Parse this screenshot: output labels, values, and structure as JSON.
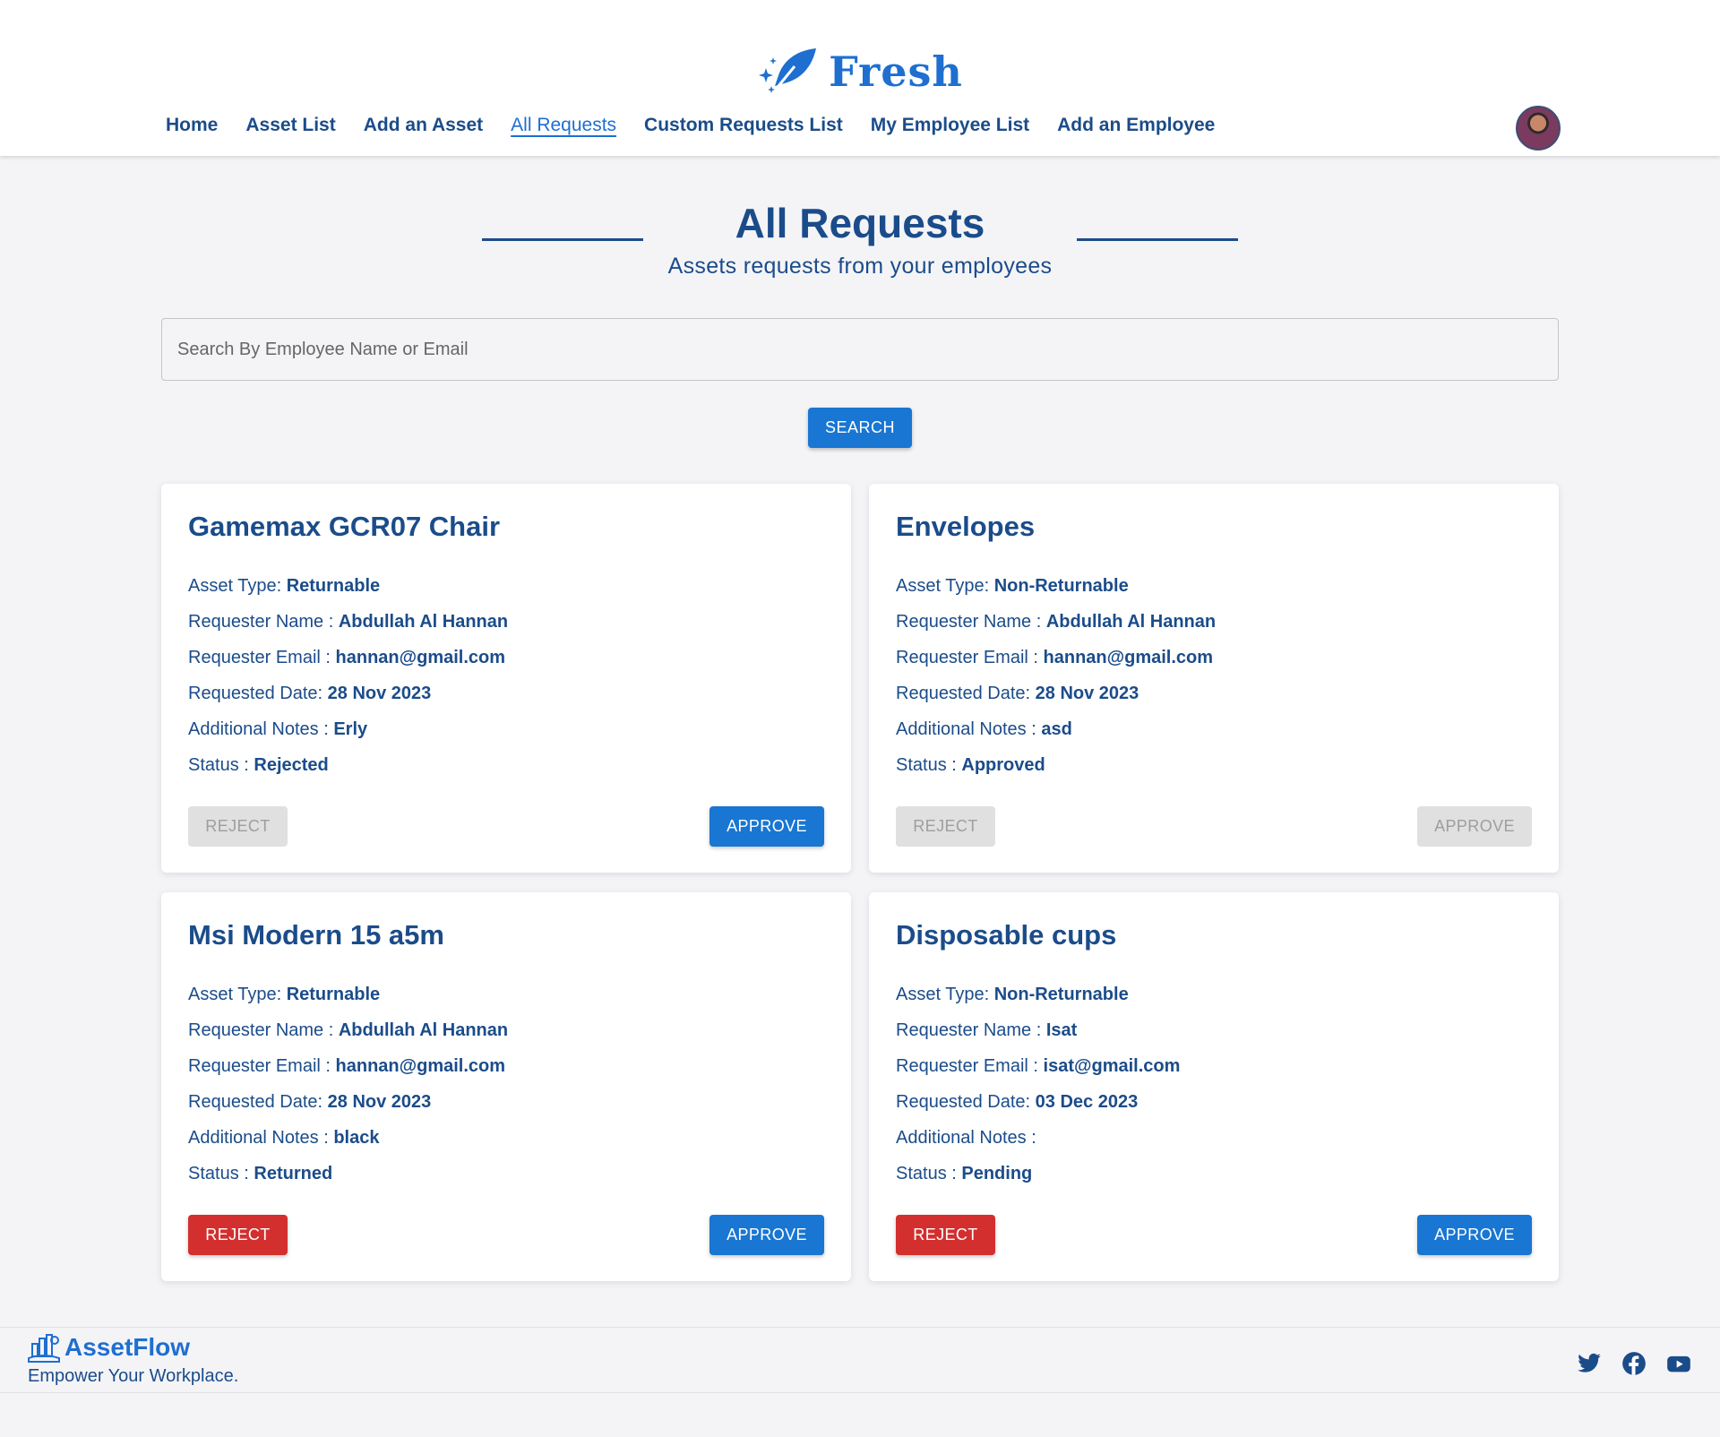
{
  "brand": {
    "name": "Fresh"
  },
  "nav": {
    "items": [
      "Home",
      "Asset List",
      "Add an Asset",
      "All Requests",
      "Custom Requests List",
      "My Employee List",
      "Add an Employee"
    ],
    "active": "All Requests"
  },
  "page": {
    "title": "All Requests",
    "subtitle": "Assets requests from your employees"
  },
  "search": {
    "placeholder": "Search By Employee Name or Email",
    "value": "",
    "button_label": "SEARCH"
  },
  "labels": {
    "asset_type": "Asset Type: ",
    "requester_name": "Requester Name : ",
    "requester_email": "Requester Email : ",
    "requested_date": "Requested Date: ",
    "additional_notes": "Additional Notes : ",
    "status": "Status : ",
    "reject": "REJECT",
    "approve": "APPROVE"
  },
  "requests": [
    {
      "title": "Gamemax GCR07 Chair",
      "asset_type": "Returnable",
      "requester_name": "Abdullah Al Hannan",
      "requester_email": "hannan@gmail.com",
      "requested_date": "28 Nov 2023",
      "additional_notes": "Erly",
      "status": "Rejected",
      "reject_enabled": false,
      "approve_enabled": true
    },
    {
      "title": "Envelopes",
      "asset_type": "Non-Returnable",
      "requester_name": "Abdullah Al Hannan",
      "requester_email": "hannan@gmail.com",
      "requested_date": "28 Nov 2023",
      "additional_notes": "asd",
      "status": "Approved",
      "reject_enabled": false,
      "approve_enabled": false
    },
    {
      "title": "Msi Modern 15 a5m",
      "asset_type": "Returnable",
      "requester_name": "Abdullah Al Hannan",
      "requester_email": "hannan@gmail.com",
      "requested_date": "28 Nov 2023",
      "additional_notes": "black",
      "status": "Returned",
      "reject_enabled": true,
      "approve_enabled": true
    },
    {
      "title": "Disposable cups",
      "asset_type": "Non-Returnable",
      "requester_name": "Isat",
      "requester_email": "isat@gmail.com",
      "requested_date": "03 Dec 2023",
      "additional_notes": "",
      "status": "Pending",
      "reject_enabled": true,
      "approve_enabled": true
    }
  ],
  "footer": {
    "brand": "AssetFlow",
    "tagline": "Empower Your Workplace.",
    "social_icons": [
      "twitter-icon",
      "facebook-icon",
      "youtube-icon"
    ]
  },
  "colors": {
    "primary": "#1976d2",
    "danger": "#d32f2f",
    "text": "#1b4c8a",
    "disabled": "#e0e0e0"
  }
}
